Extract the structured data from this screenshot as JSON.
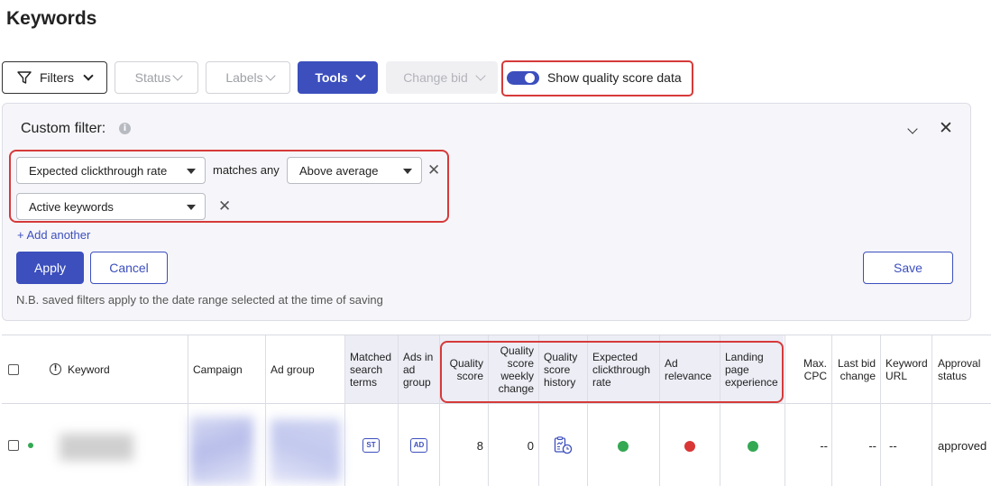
{
  "page": {
    "title": "Keywords"
  },
  "toolbar": {
    "filters_label": "Filters",
    "status_label": "Status",
    "labels_label": "Labels",
    "tools_label": "Tools",
    "change_bid_label": "Change bid",
    "quality_toggle_label": "Show quality score data",
    "quality_toggle_on": true
  },
  "filter_panel": {
    "title": "Custom filter:",
    "condition_field": "Expected clickthrough rate",
    "operator": "matches any",
    "condition_value": "Above average",
    "keyword_scope": "Active keywords",
    "add_another": "+ Add another",
    "apply": "Apply",
    "cancel": "Cancel",
    "save": "Save",
    "note": "N.B. saved filters apply to the date range selected at the time of saving"
  },
  "table": {
    "headers": {
      "keyword": "Keyword",
      "campaign": "Campaign",
      "ad_group": "Ad group",
      "matched_search_terms": [
        "Matched",
        "search",
        "terms"
      ],
      "ads_in_ad_group": [
        "Ads in",
        "ad",
        "group"
      ],
      "quality_score": [
        "Quality",
        "score"
      ],
      "qs_weekly_change": [
        "Quality",
        "score",
        "weekly",
        "change"
      ],
      "qs_history": [
        "Quality",
        "score",
        "history"
      ],
      "expected_ctr": [
        "Expected",
        "clickthrough",
        "rate"
      ],
      "ad_relevance": [
        "Ad",
        "relevance"
      ],
      "landing_page": [
        "Landing",
        "page",
        "experience"
      ],
      "max_cpc": [
        "Max.",
        "CPC"
      ],
      "last_bid_change": [
        "Last bid",
        "change"
      ],
      "keyword_url": [
        "Keyword",
        "URL"
      ],
      "approval_status": [
        "Approval",
        "status"
      ]
    },
    "row": {
      "matched_badge": "ST",
      "ads_badge": "AD",
      "quality_score": "8",
      "qs_weekly_change": "0",
      "expected_ctr_color": "#34a853",
      "ad_relevance_color": "#d93636",
      "landing_page_color": "#34a853",
      "max_cpc": "--",
      "last_bid_change": "--",
      "keyword_url": "--",
      "approval_status": "approved"
    }
  },
  "colors": {
    "accent": "#3c4fbd",
    "highlight": "#d63a3a",
    "good": "#34a853",
    "bad": "#d93636"
  }
}
